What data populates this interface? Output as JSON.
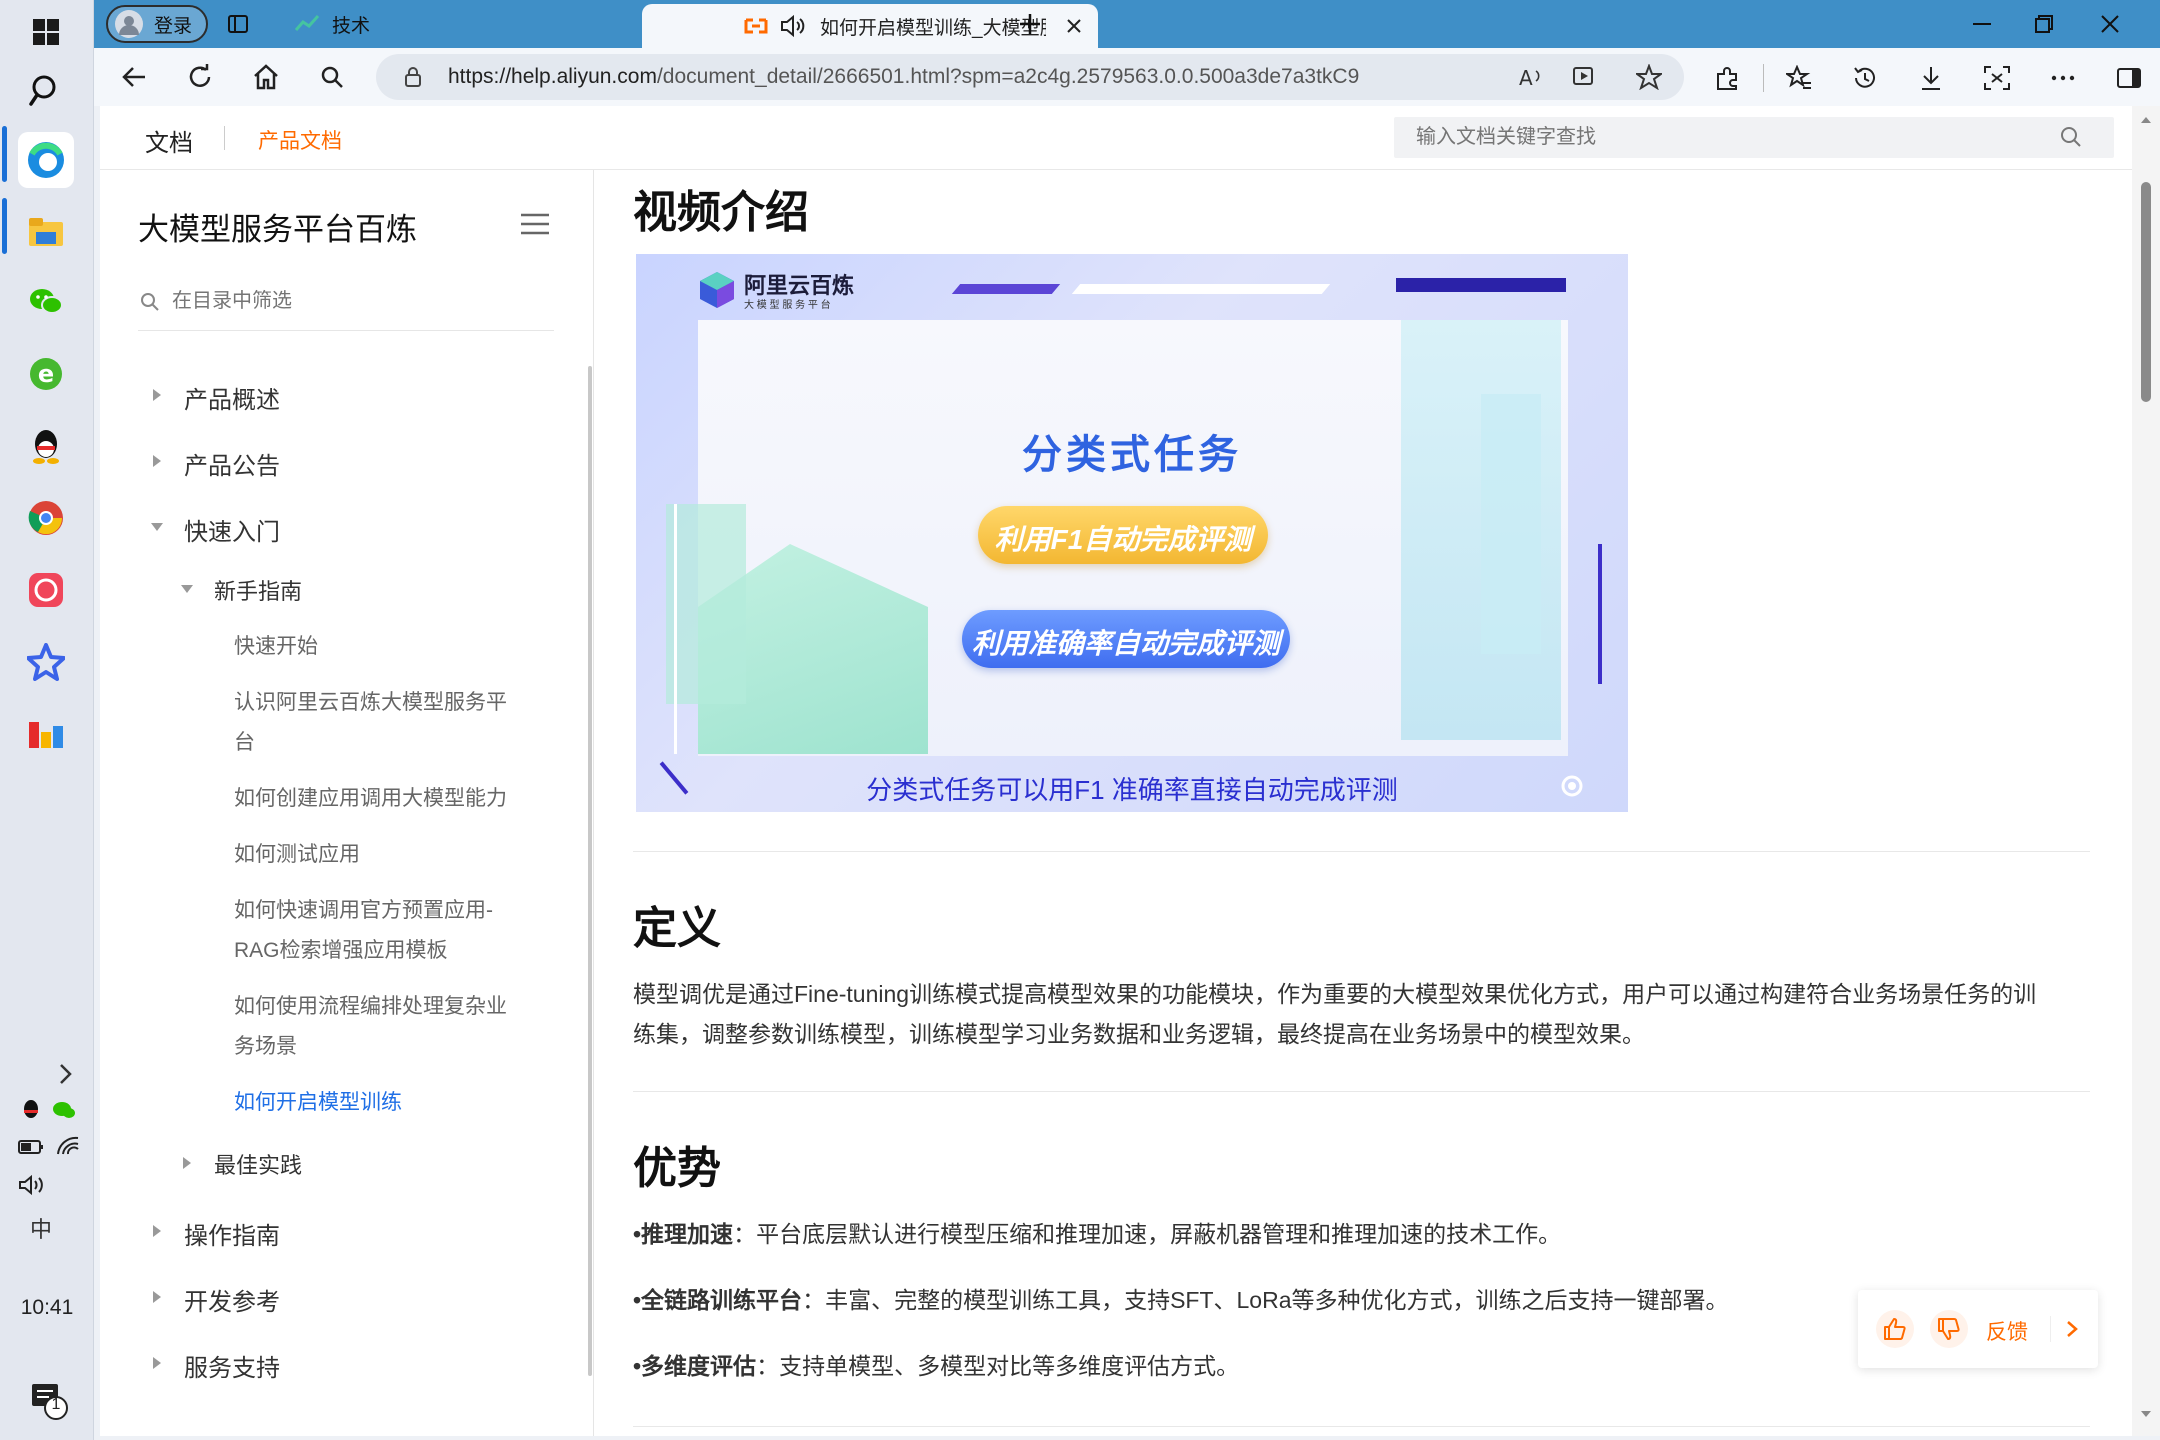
{
  "taskbar": {
    "clock": "10:41",
    "notification_count": "1",
    "ime": "中"
  },
  "tabs": {
    "profile_label": "登录",
    "tab1_label": "技术",
    "tab2_label": "如何开启模型训练_大模型服"
  },
  "address": {
    "url_host": "https://help.aliyun.com",
    "url_path": "/document_detail/2666501.html?spm=a2c4g.2579563.0.0.500a3de7a3tkC9"
  },
  "topnav": {
    "docs": "文档",
    "product_docs": "产品文档",
    "search_placeholder": "输入文档关键字查找"
  },
  "sidebar": {
    "title": "大模型服务平台百炼",
    "filter_placeholder": "在目录中筛选",
    "items": [
      {
        "label": "产品概述"
      },
      {
        "label": "产品公告"
      },
      {
        "label": "快速入门"
      },
      {
        "label": "新手指南"
      },
      {
        "label": "快速开始"
      },
      {
        "label": "认识阿里云百炼大模型服务平"
      },
      {
        "label": "台"
      },
      {
        "label": "如何创建应用调用大模型能力"
      },
      {
        "label": "如何测试应用"
      },
      {
        "label": "如何快速调用官方预置应用-"
      },
      {
        "label": "RAG检索增强应用模板"
      },
      {
        "label": "如何使用流程编排处理复杂业"
      },
      {
        "label": "务场景"
      },
      {
        "label": "如何开启模型训练"
      },
      {
        "label": "最佳实践"
      },
      {
        "label": "操作指南"
      },
      {
        "label": "开发参考"
      },
      {
        "label": "服务支持"
      }
    ]
  },
  "content": {
    "video_heading": "视频介绍",
    "video": {
      "brand": "阿里云百炼",
      "brand_sub": "大 模 型 服 务 平 台",
      "title": "分类式任务",
      "badge1": "利用F1自动完成评测",
      "badge2": "利用准确率自动完成评测",
      "caption": "分类式任务可以用F1 准确率直接自动完成评测"
    },
    "def_heading": "定义",
    "def_line1": "模型调优是通过Fine-tuning训练模式提高模型效果的功能模块，作为重要的大模型效果优化方式，用户可以通过构建符合业务场景任务的训",
    "def_line2": "练集，调整参数训练模型，训练模型学习业务数据和业务逻辑，最终提高在业务场景中的模型效果。",
    "adv_heading": "优势",
    "adv": [
      {
        "bold": "•推理加速",
        "text": "：平台底层默认进行模型压缩和推理加速，屏蔽机器管理和推理加速的技术工作。"
      },
      {
        "bold": "•全链路训练平台",
        "text": "：丰富、完整的模型训练工具，支持SFT、LoRa等多种优化方式，训练之后支持一键部署。"
      },
      {
        "bold": "•多维度评估",
        "text": "：支持单模型、多模型对比等多维度评估方式。"
      }
    ]
  },
  "feedback": {
    "label": "反馈"
  },
  "colors": {
    "accent_orange": "#ff6a00",
    "link_blue": "#1f6fe6",
    "tabstrip": "#3f8fc7"
  }
}
